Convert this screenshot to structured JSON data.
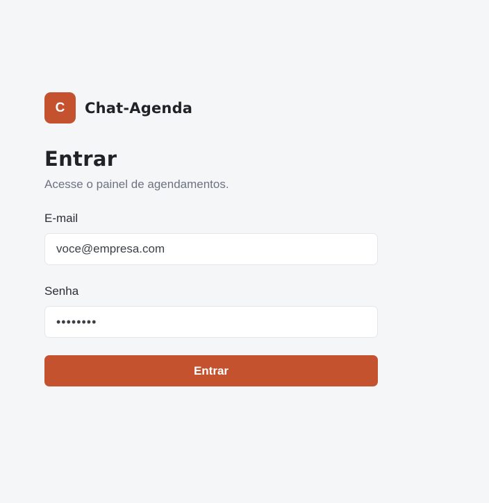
{
  "brand": {
    "logo_letter": "C",
    "name": "Chat-Agenda",
    "accent_color": "#c4522f"
  },
  "login": {
    "title": "Entrar",
    "subtitle": "Acesse o painel de agendamentos.",
    "email_label": "E-mail",
    "email_value": "voce@empresa.com",
    "password_label": "Senha",
    "password_mask": "••••••••",
    "submit_label": "Entrar"
  }
}
